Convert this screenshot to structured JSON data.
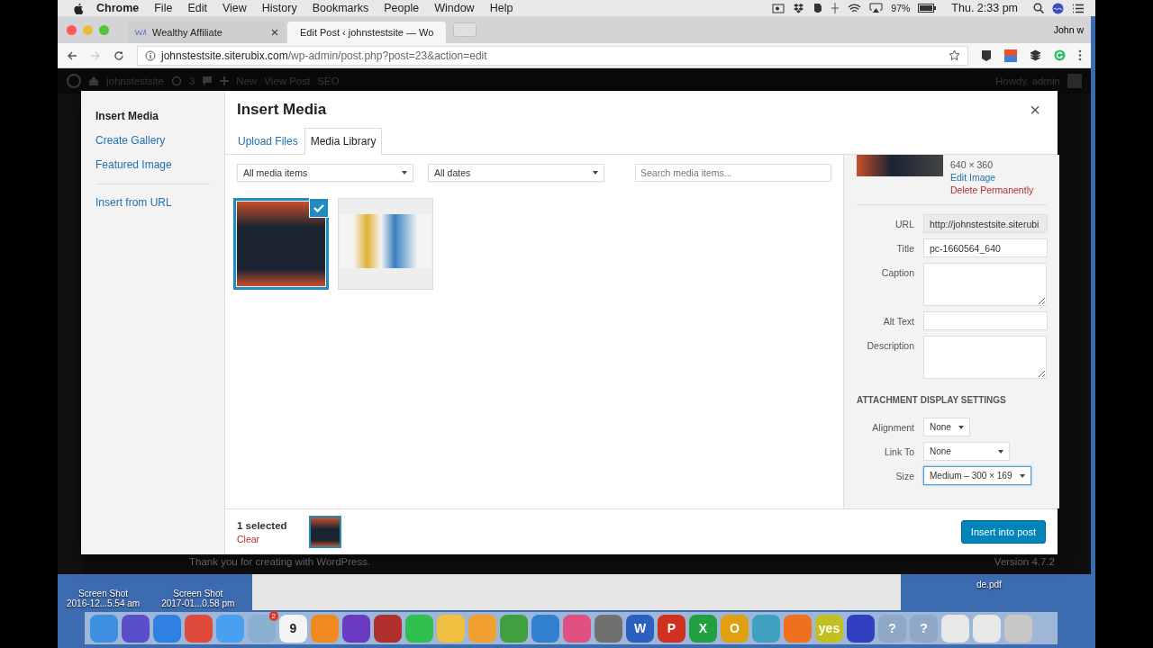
{
  "menubar": {
    "app": "Chrome",
    "menus": [
      "File",
      "Edit",
      "View",
      "History",
      "Bookmarks",
      "People",
      "Window",
      "Help"
    ],
    "battery": "97%",
    "clock": "Thu. 2:33 pm"
  },
  "browser": {
    "tabs": [
      {
        "title": "Wealthy Affiliate",
        "selected": false
      },
      {
        "title": "Edit Post ‹ johnstestsite — Wo",
        "selected": true
      }
    ],
    "profile": "John w",
    "url_host": "johnstestsite.siterubix.com",
    "url_path": "/wp-admin/post.php?post=23&action=edit"
  },
  "admin_bar": {
    "site": "johnstestsite",
    "updates": "3",
    "new": "New",
    "view_post": "View Post",
    "seo": "SEO",
    "greeting": "Howdy, admin"
  },
  "modal": {
    "menu_groups": [
      [
        {
          "label": "Insert Media",
          "selected": true
        },
        {
          "label": "Create Gallery",
          "selected": false
        },
        {
          "label": "Featured Image",
          "selected": false
        }
      ],
      [
        {
          "label": "Insert from URL",
          "selected": false
        }
      ]
    ],
    "title": "Insert Media",
    "close": "×",
    "tabs": [
      {
        "label": "Upload Files",
        "selected": false
      },
      {
        "label": "Media Library",
        "selected": true
      }
    ],
    "filters": [
      {
        "kind": "select",
        "value": "All media items"
      },
      {
        "kind": "select",
        "value": "All dates"
      },
      {
        "kind": "search",
        "placeholder": "Search media items..."
      }
    ],
    "attachments": [
      {
        "selected": true
      },
      {
        "selected": false
      }
    ],
    "details": {
      "dimensions": "640 × 360",
      "edit": "Edit Image",
      "delete": "Delete Permanently",
      "fields": [
        {
          "label": "URL",
          "kind": "readonly",
          "value": "http://johnstestsite.siterubi"
        },
        {
          "label": "Title",
          "kind": "text",
          "value": "pc-1660564_640"
        },
        {
          "label": "Caption",
          "kind": "textarea"
        },
        {
          "label": "Alt Text",
          "kind": "text"
        },
        {
          "label": "Description",
          "kind": "textarea"
        }
      ]
    },
    "display_settings": {
      "heading": "ATTACHMENT DISPLAY SETTINGS",
      "settings": [
        {
          "label": "Alignment",
          "value": "None",
          "focused": false
        },
        {
          "label": "Link To",
          "value": "None",
          "focused": false
        },
        {
          "label": "Size",
          "value": "Medium – 300 × 169",
          "focused": true
        }
      ]
    },
    "selection": {
      "count": "1 selected",
      "clear": "Clear"
    },
    "insert_button": "Insert into post"
  },
  "footer": {
    "thanks": "Thank you for creating with WordPress.",
    "version": "Version 4.7.2"
  },
  "desktop": {
    "files": [
      {
        "name": "Screen Shot",
        "detail": "2016-12...5.54 am"
      },
      {
        "name": "Screen Shot",
        "detail": "2017-01...0.58 pm"
      }
    ],
    "pdf": "de.pdf"
  },
  "dock": [
    {
      "color": "#3f8fe0"
    },
    {
      "color": "#5a4fc8"
    },
    {
      "color": "#2f80e0"
    },
    {
      "color": "#e04a3a"
    },
    {
      "color": "#4aa0f0"
    },
    {
      "color": "#8ab0d0",
      "badge": "2"
    },
    {
      "color": "#f4f4f4",
      "glyph": "9"
    },
    {
      "color": "#f08a20"
    },
    {
      "color": "#6a3ac0"
    },
    {
      "color": "#b03030"
    },
    {
      "color": "#30c050"
    },
    {
      "color": "#f0c040"
    },
    {
      "color": "#f0a030"
    },
    {
      "color": "#40a040"
    },
    {
      "color": "#3080d0"
    },
    {
      "color": "#e05080"
    },
    {
      "color": "#707070"
    },
    {
      "color": "#2a60c0",
      "glyph": "W"
    },
    {
      "color": "#d03020",
      "glyph": "P"
    },
    {
      "color": "#20a040",
      "glyph": "X"
    },
    {
      "color": "#e0a010",
      "glyph": "O"
    },
    {
      "color": "#40a0c0"
    },
    {
      "color": "#f07020"
    },
    {
      "color": "#c0c020",
      "glyph": "yes"
    },
    {
      "color": "#3040c0"
    },
    {
      "color": "#90a8c8",
      "glyph": "?"
    },
    {
      "color": "#90a8c8",
      "glyph": "?"
    },
    {
      "color": "#e8e8e8"
    },
    {
      "color": "#e8e8e8"
    },
    {
      "color": "#c8c8c8"
    }
  ]
}
